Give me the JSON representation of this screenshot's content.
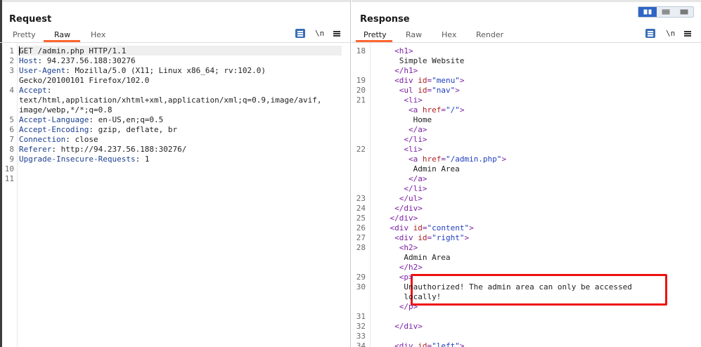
{
  "request": {
    "title": "Request",
    "tabs": [
      "Pretty",
      "Raw",
      "Hex"
    ],
    "active_tab": "Raw",
    "tools": {
      "wrap_icon": "wrap-lines-icon",
      "newline_label": "\\n",
      "menu_icon": "menu-icon"
    },
    "line_numbers": [
      "1",
      "2",
      "3",
      "4",
      "5",
      "6",
      "7",
      "8",
      "9",
      "10",
      "11"
    ],
    "lines": [
      {
        "name": "",
        "value": "GET /admin.php HTTP/1.1"
      },
      {
        "name": "Host",
        "value": ": 94.237.56.188:30276"
      },
      {
        "name": "User-Agent",
        "value": ": Mozilla/5.0 (X11; Linux x86_64; rv:102.0)"
      },
      {
        "name": "",
        "value": "Gecko/20100101 Firefox/102.0"
      },
      {
        "name": "Accept",
        "value": ":"
      },
      {
        "name": "",
        "value": "text/html,application/xhtml+xml,application/xml;q=0.9,image/avif,"
      },
      {
        "name": "",
        "value": "image/webp,*/*;q=0.8"
      },
      {
        "name": "Accept-Language",
        "value": ": en-US,en;q=0.5"
      },
      {
        "name": "Accept-Encoding",
        "value": ": gzip, deflate, br"
      },
      {
        "name": "Connection",
        "value": ": close"
      },
      {
        "name": "Referer",
        "value": ": http://94.237.56.188:30276/"
      },
      {
        "name": "Upgrade-Insecure-Requests",
        "value": ": 1"
      }
    ]
  },
  "response": {
    "title": "Response",
    "tabs": [
      "Pretty",
      "Raw",
      "Hex",
      "Render"
    ],
    "active_tab": "Pretty",
    "tools": {
      "wrap_icon": "wrap-lines-icon",
      "newline_label": "\\n",
      "menu_icon": "menu-icon"
    },
    "line_numbers": [
      {
        "row": 0,
        "n": "18"
      },
      {
        "row": 3,
        "n": "19"
      },
      {
        "row": 4,
        "n": "20"
      },
      {
        "row": 5,
        "n": "21"
      },
      {
        "row": 10,
        "n": "22"
      },
      {
        "row": 15,
        "n": "23"
      },
      {
        "row": 16,
        "n": "24"
      },
      {
        "row": 17,
        "n": "25"
      },
      {
        "row": 18,
        "n": "26"
      },
      {
        "row": 19,
        "n": "27"
      },
      {
        "row": 20,
        "n": "28"
      },
      {
        "row": 23,
        "n": "29"
      },
      {
        "row": 24,
        "n": "30"
      },
      {
        "row": 27,
        "n": "31"
      },
      {
        "row": 28,
        "n": "32"
      },
      {
        "row": 29,
        "n": "33"
      },
      {
        "row": 30,
        "n": "34"
      }
    ],
    "code": [
      [
        [
          "tag",
          "<h1>"
        ]
      ],
      [
        [
          "txt",
          "Simple Website"
        ]
      ],
      [
        [
          "tag",
          "</h1>"
        ]
      ],
      [
        [
          "tag",
          "<div "
        ],
        [
          "attr",
          "id"
        ],
        [
          "tag",
          "="
        ],
        [
          "str",
          "\"menu\""
        ],
        [
          "tag",
          ">"
        ]
      ],
      [
        [
          "tag",
          "<ul "
        ],
        [
          "attr",
          "id"
        ],
        [
          "tag",
          "="
        ],
        [
          "str",
          "\"nav\""
        ],
        [
          "tag",
          ">"
        ]
      ],
      [
        [
          "tag",
          "<li>"
        ]
      ],
      [
        [
          "tag",
          "<a "
        ],
        [
          "attr",
          "href"
        ],
        [
          "tag",
          "="
        ],
        [
          "str",
          "\"/\""
        ],
        [
          "tag",
          ">"
        ]
      ],
      [
        [
          "txt",
          "Home"
        ]
      ],
      [
        [
          "tag",
          "</a>"
        ]
      ],
      [
        [
          "tag",
          "</li>"
        ]
      ],
      [
        [
          "tag",
          "<li>"
        ]
      ],
      [
        [
          "tag",
          "<a "
        ],
        [
          "attr",
          "href"
        ],
        [
          "tag",
          "="
        ],
        [
          "str",
          "\"/admin.php\""
        ],
        [
          "tag",
          ">"
        ]
      ],
      [
        [
          "txt",
          "Admin Area"
        ]
      ],
      [
        [
          "tag",
          "</a>"
        ]
      ],
      [
        [
          "tag",
          "</li>"
        ]
      ],
      [
        [
          "tag",
          "</ul>"
        ]
      ],
      [
        [
          "tag",
          "</div>"
        ]
      ],
      [
        [
          "tag",
          "</div>"
        ]
      ],
      [
        [
          "tag",
          "<div "
        ],
        [
          "attr",
          "id"
        ],
        [
          "tag",
          "="
        ],
        [
          "str",
          "\"content\""
        ],
        [
          "tag",
          ">"
        ]
      ],
      [
        [
          "tag",
          "<div "
        ],
        [
          "attr",
          "id"
        ],
        [
          "tag",
          "="
        ],
        [
          "str",
          "\"right\""
        ],
        [
          "tag",
          ">"
        ]
      ],
      [
        [
          "tag",
          "<h2>"
        ]
      ],
      [
        [
          "txt",
          "Admin Area"
        ]
      ],
      [
        [
          "tag",
          "</h2>"
        ]
      ],
      [
        [
          "tag",
          "<p>"
        ]
      ],
      [
        [
          "txt",
          "Unauthorized! The admin area can only be accessed"
        ]
      ],
      [
        [
          "txt",
          "locally!"
        ]
      ],
      [
        [
          "tag",
          "</p>"
        ]
      ],
      [],
      [
        [
          "tag",
          "</div>"
        ]
      ],
      [],
      [
        [
          "tag",
          "<div "
        ],
        [
          "attr",
          "id"
        ],
        [
          "tag",
          "="
        ],
        [
          "str",
          "\"left\""
        ],
        [
          "tag",
          ">"
        ]
      ]
    ]
  },
  "view_toggle": {
    "options": [
      "side-by-side-icon",
      "stacked-icon",
      "tabbed-icon"
    ],
    "active": "side-by-side-icon"
  },
  "colors": {
    "accent_orange": "#ff6633",
    "highlight_red": "#ee1111",
    "toggle_blue": "#2f65c6"
  }
}
